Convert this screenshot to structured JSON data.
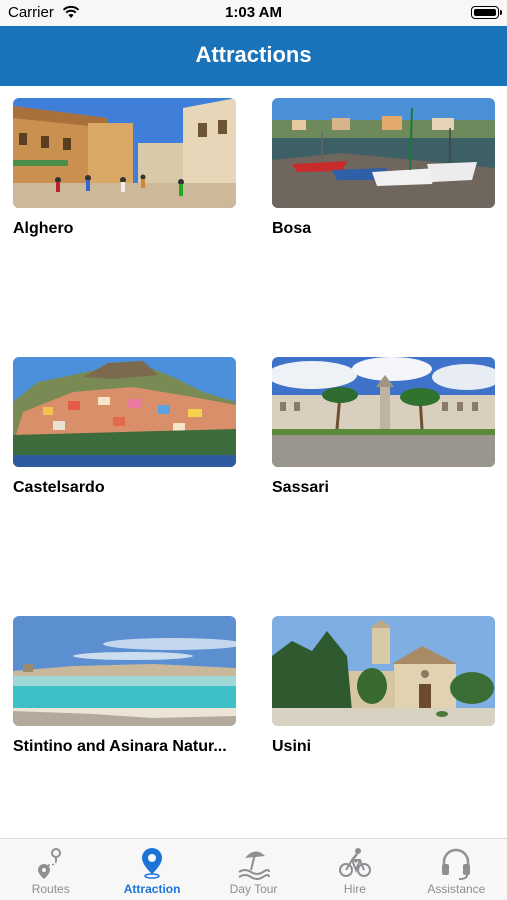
{
  "status_bar": {
    "carrier": "Carrier",
    "time": "1:03 AM"
  },
  "header": {
    "title": "Attractions"
  },
  "attractions": [
    {
      "name": "Alghero",
      "image": "alghero-street-photo"
    },
    {
      "name": "Bosa",
      "image": "bosa-river-boats-photo"
    },
    {
      "name": "Castelsardo",
      "image": "castelsardo-hill-town-photo"
    },
    {
      "name": "Sassari",
      "image": "sassari-square-palms-photo"
    },
    {
      "name": "Stintino and Asinara Natur...",
      "image": "stintino-beach-photo"
    },
    {
      "name": "Usini",
      "image": "usini-church-photo"
    }
  ],
  "tab_bar": {
    "active": "Attraction",
    "active_color": "#1b74d6",
    "items": [
      {
        "label": "Routes",
        "icon": "route-pins-icon"
      },
      {
        "label": "Attraction",
        "icon": "location-pin-icon"
      },
      {
        "label": "Day Tour",
        "icon": "beach-umbrella-icon"
      },
      {
        "label": "Hire",
        "icon": "bicycle-rider-icon"
      },
      {
        "label": "Assistance",
        "icon": "headset-icon"
      }
    ]
  },
  "colors": {
    "header": "#1a73b8",
    "background": "#ffffff"
  }
}
